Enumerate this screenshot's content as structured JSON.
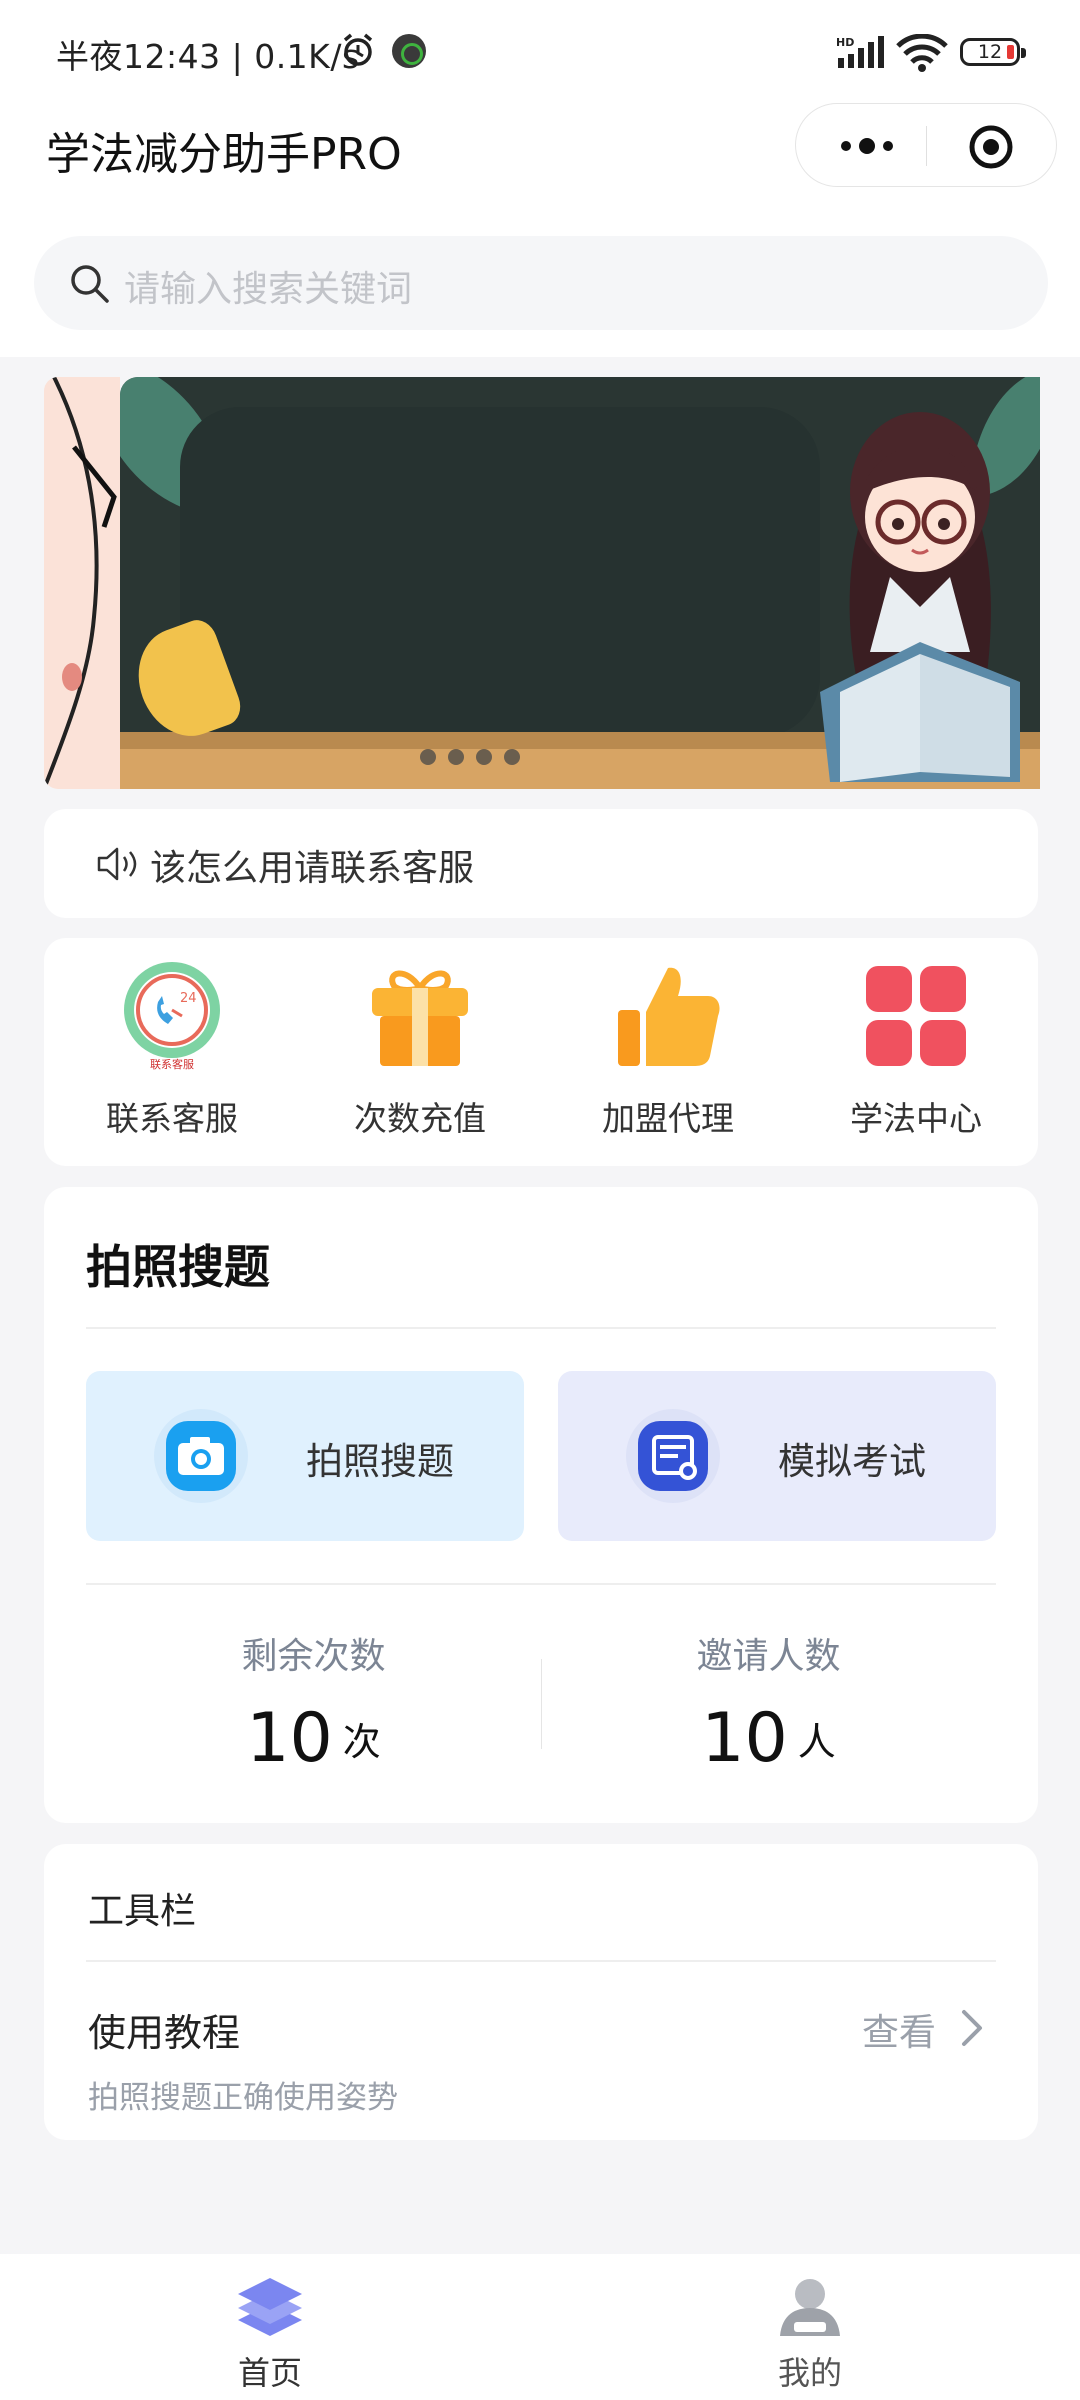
{
  "status_bar": {
    "time": "半夜12:43 | 0.1K/s",
    "battery": "12",
    "icons": [
      "alarm-icon",
      "app-notification-icon",
      "hd-signal-icon",
      "wifi-icon",
      "battery-icon"
    ]
  },
  "header": {
    "title": "学法减分助手PRO",
    "capsule_icons": [
      "more-icon",
      "close-target-icon"
    ]
  },
  "search": {
    "placeholder": "请输入搜索关键词",
    "icon": "search-icon"
  },
  "banner": {
    "description_icons": [
      "megaphone-icon",
      "teacher-illustration"
    ]
  },
  "notice": {
    "text": "该怎么用请联系客服",
    "icon": "speaker-icon"
  },
  "entries": [
    {
      "label": "联系客服",
      "icon": "customer-service-icon",
      "sub": "联系客服"
    },
    {
      "label": "次数充值",
      "icon": "gift-icon"
    },
    {
      "label": "加盟代理",
      "icon": "thumbs-up-icon"
    },
    {
      "label": "学法中心",
      "icon": "grid-icon"
    }
  ],
  "photo_section": {
    "title": "拍照搜题",
    "tiles": [
      {
        "label": "拍照搜题",
        "icon": "camera-icon"
      },
      {
        "label": "模拟考试",
        "icon": "exam-icon"
      }
    ],
    "stats": [
      {
        "label": "剩余次数",
        "value": "10",
        "unit": "次"
      },
      {
        "label": "邀请人数",
        "value": "10",
        "unit": "人"
      }
    ]
  },
  "tools": {
    "header": "工具栏",
    "rows": [
      {
        "title": "使用教程",
        "subtitle": "拍照搜题正确使用姿势",
        "action": "查看"
      }
    ]
  },
  "tabbar": {
    "tabs": [
      {
        "label": "首页",
        "icon": "home-layers-icon",
        "active": true
      },
      {
        "label": "我的",
        "icon": "user-icon",
        "active": false
      }
    ]
  },
  "colors": {
    "tile_blue": "#e0f1fe",
    "tile_indigo": "#e8ebfb",
    "camera": "#1aa0f0",
    "exam": "#3453d6",
    "grid_red": "#f0515f",
    "gift_orange": "#f99a1e",
    "tab_active": "#333333",
    "tab_inactive": "#555555"
  }
}
